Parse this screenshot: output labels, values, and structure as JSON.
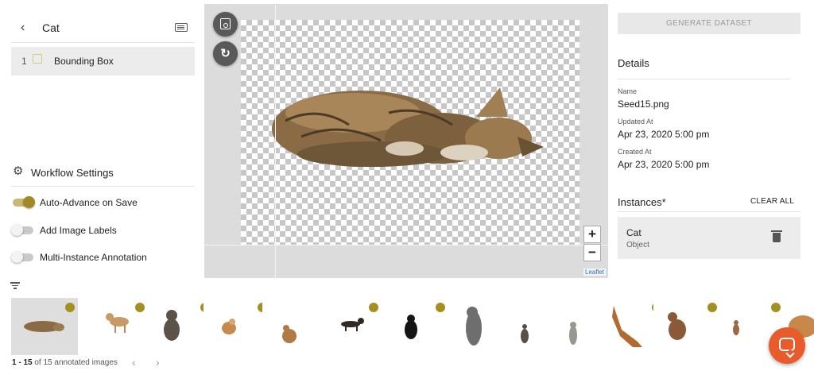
{
  "left_panel": {
    "class_title": "Cat",
    "tools": [
      {
        "number": "1",
        "label": "Bounding Box"
      }
    ],
    "workflow": {
      "title": "Workflow Settings",
      "settings": [
        {
          "label": "Auto-Advance on Save",
          "enabled": true
        },
        {
          "label": "Add Image Labels",
          "enabled": false
        },
        {
          "label": "Multi-Instance Annotation",
          "enabled": false
        }
      ]
    }
  },
  "canvas": {
    "zoom_in": "+",
    "zoom_out": "−",
    "attribution": "Leaflet"
  },
  "right_panel": {
    "generate_button": "GENERATE DATASET",
    "details_title": "Details",
    "name_label": "Name",
    "name_value": "Seed15.png",
    "updated_label": "Updated At",
    "updated_value": "Apr 23, 2020 5:00 pm",
    "created_label": "Created At",
    "created_value": "Apr 23, 2020 5:00 pm",
    "instances_title": "Instances*",
    "clear_all": "CLEAR ALL",
    "instances": [
      {
        "name": "Cat",
        "type": "Object"
      }
    ]
  },
  "bottom": {
    "counter_range": "1 - 15",
    "counter_rest": " of 15 annotated images",
    "prev": "‹",
    "next": "›"
  },
  "colors": {
    "accent": "#a68f21",
    "chat": "#e85c2b"
  }
}
